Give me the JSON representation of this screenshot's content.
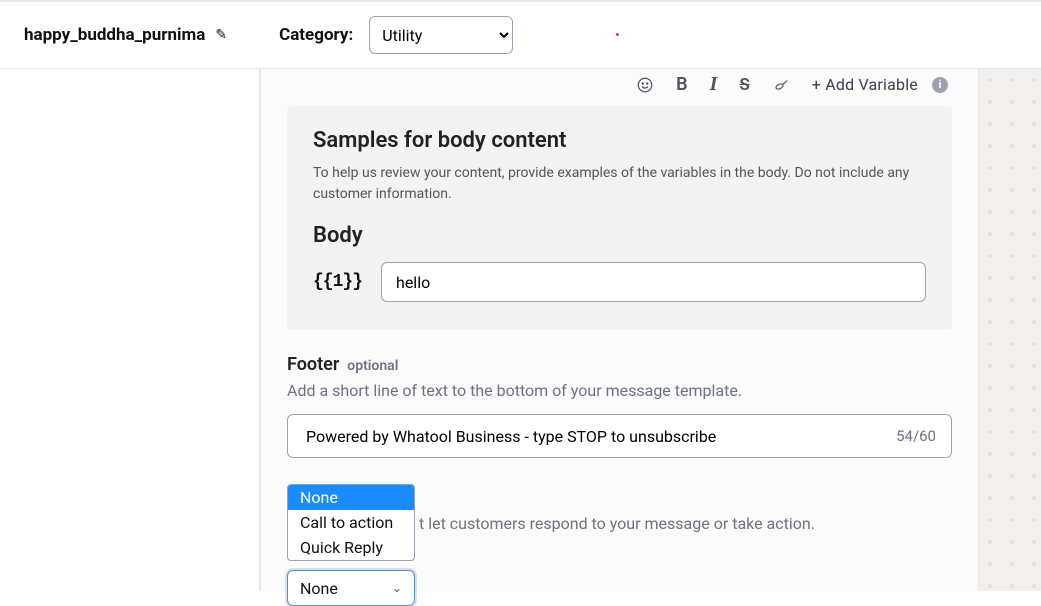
{
  "header": {
    "template_name": "happy_buddha_purnima",
    "category_label": "Category:",
    "category_value": "Utility"
  },
  "toolbar": {
    "bold": "B",
    "italic": "I",
    "strike": "S",
    "add_variable": "+  Add Variable",
    "info": "i"
  },
  "samples": {
    "title": "Samples for body content",
    "desc": "To help us review your content, provide examples of the variables in the body. Do not include any customer information.",
    "body_label": "Body",
    "var1_tag": "{{1}}",
    "var1_value": "hello"
  },
  "footer": {
    "title": "Footer",
    "optional": "optional",
    "desc": "Add a short line of text to the bottom of your message template.",
    "value": "Powered by Whatool Business - type STOP to unsubscribe",
    "count": "54/60"
  },
  "buttons": {
    "options": [
      "None",
      "Call to action",
      "Quick Reply"
    ],
    "selected": "None",
    "desc": "t let customers respond to your message or take action."
  }
}
